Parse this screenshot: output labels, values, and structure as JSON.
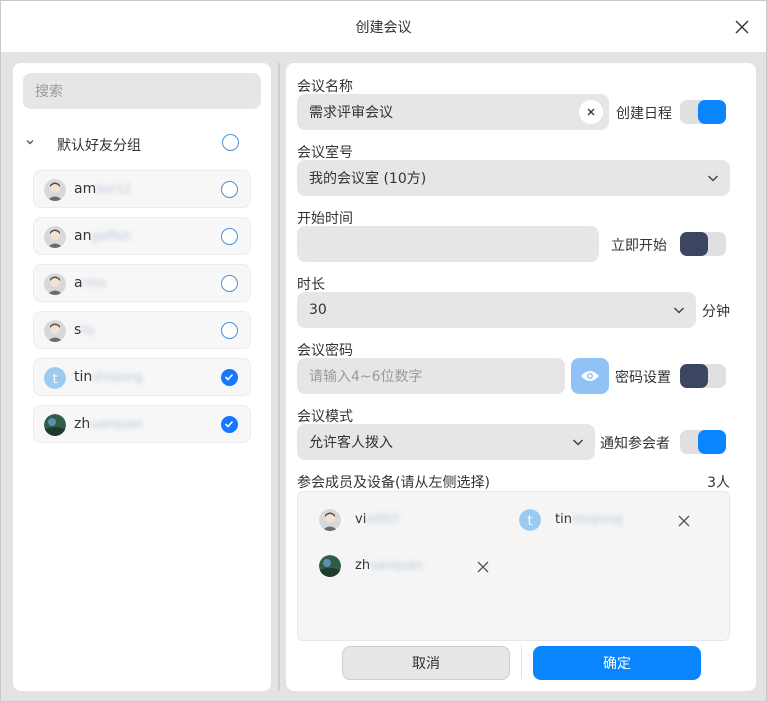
{
  "window": {
    "title": "创建会议"
  },
  "left": {
    "search_placeholder": "搜索",
    "group": {
      "label": "默认好友分组"
    },
    "contacts": [
      {
        "prefix": "am",
        "rest": "ber12",
        "checked": false
      },
      {
        "prefix": "an",
        "rest": "gelfish",
        "checked": false
      },
      {
        "prefix": "a",
        "rest": "nita",
        "checked": false
      },
      {
        "prefix": "s",
        "rest": "ily",
        "checked": false
      },
      {
        "prefix": "tin",
        "rest": "shiqiong",
        "checked": true
      },
      {
        "prefix": "zh",
        "rest": "uanquan",
        "checked": true
      }
    ]
  },
  "form": {
    "name": {
      "label": "会议名称",
      "value": "需求评审会议",
      "toggle_label": "创建日程",
      "toggle_on": true
    },
    "room": {
      "label": "会议室号",
      "value": "我的会议室 (10方)"
    },
    "start": {
      "label": "开始时间",
      "value": "",
      "toggle_label": "立即开始",
      "toggle_on": false
    },
    "duration": {
      "label": "时长",
      "value": "30",
      "unit": "分钟"
    },
    "password": {
      "label": "会议密码",
      "placeholder": "请输入4~6位数字",
      "toggle_label": "密码设置",
      "toggle_on": false
    },
    "mode": {
      "label": "会议模式",
      "value": "允许客人拨入",
      "toggle_label": "通知参会者",
      "toggle_on": true
    },
    "members": {
      "label": "参会成员及设备(请从左侧选择)",
      "count": "3人",
      "items": [
        {
          "prefix": "vi",
          "rest": "ki007"
        },
        {
          "prefix": "tin",
          "rest": "shiqiong"
        },
        {
          "prefix": "zh",
          "rest": "uanquan"
        }
      ]
    }
  },
  "footer": {
    "cancel": "取消",
    "ok": "确定"
  },
  "colors": {
    "accent": "#0a84ff",
    "toggle_off_knob": "#3c4660",
    "eye_button": "#8fc3f5"
  }
}
